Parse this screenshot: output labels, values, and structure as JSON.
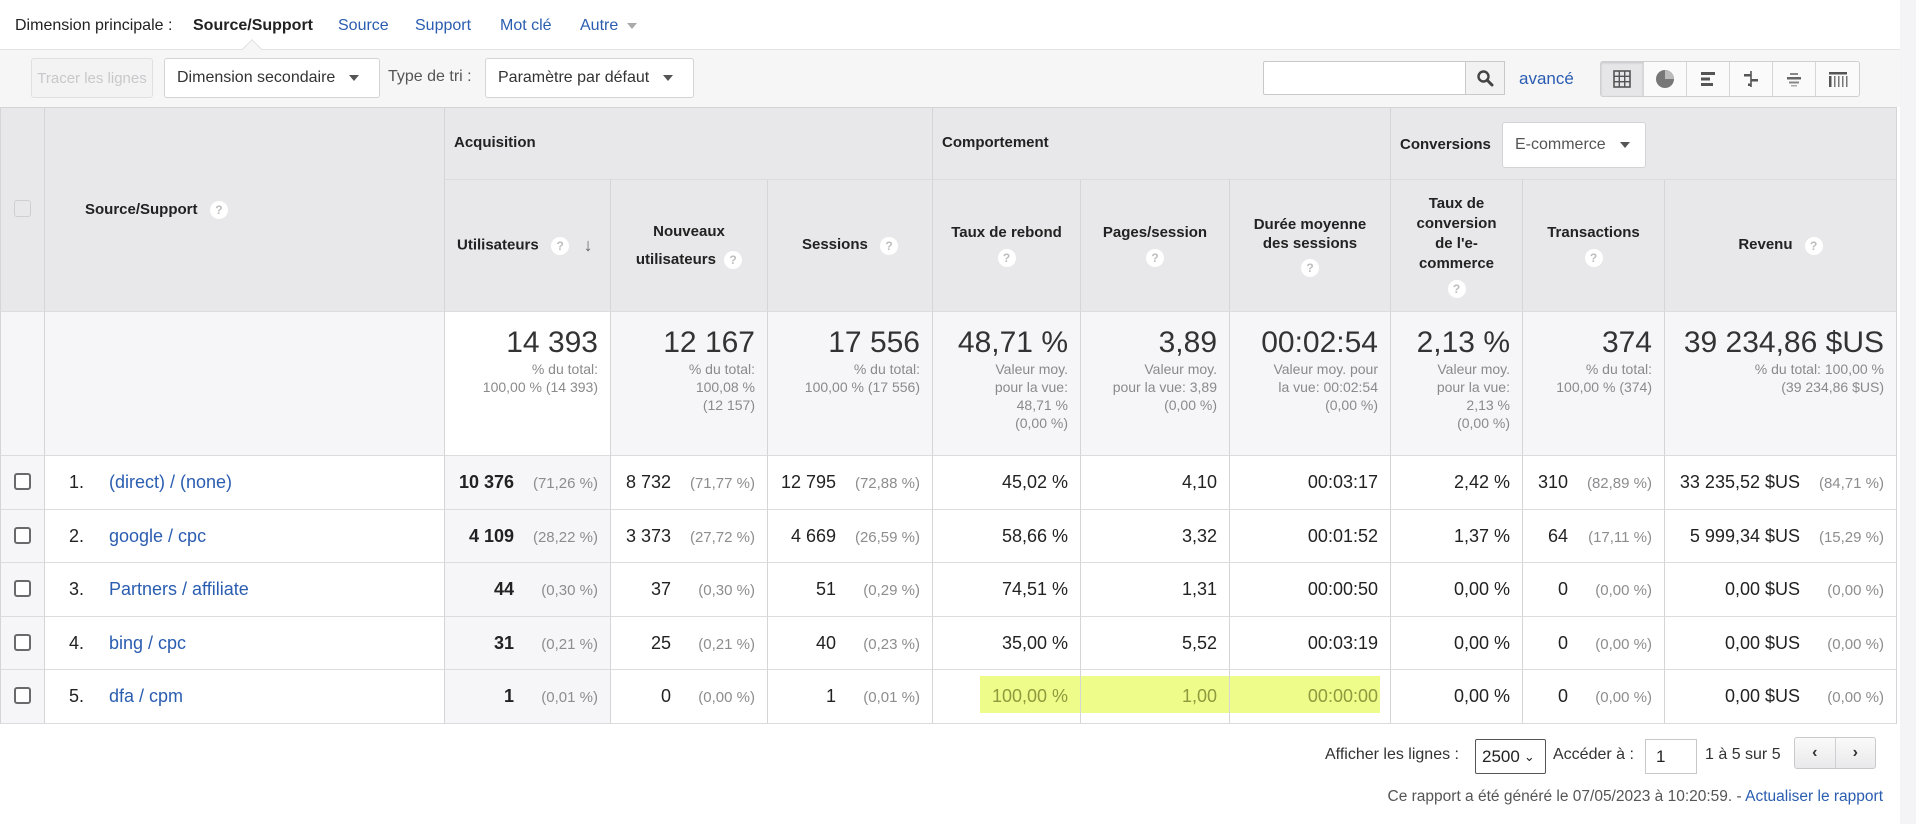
{
  "dimension_bar": {
    "label": "Dimension principale :",
    "active": "Source/Support",
    "links": [
      "Source",
      "Support",
      "Mot clé",
      "Autre"
    ]
  },
  "toolbar": {
    "plot_rows": "Tracer les lignes",
    "secondary_dimension": "Dimension secondaire",
    "sort_type_label": "Type de tri :",
    "sort_type_value": "Paramètre par défaut",
    "search_value": "",
    "advanced": "avancé",
    "view_buttons": [
      "table-view",
      "pie-view",
      "performance-view",
      "comparison-view",
      "term-cloud-view",
      "pivot-view"
    ]
  },
  "table": {
    "dimension_header": "Source/Support",
    "groups": {
      "acquisition": "Acquisition",
      "behavior": "Comportement",
      "conversions": "Conversions",
      "conversions_select": "E-commerce"
    },
    "columns": [
      {
        "key": "users",
        "label": "Utilisateurs"
      },
      {
        "key": "new_users",
        "label": "Nouveaux utilisateurs"
      },
      {
        "key": "sessions",
        "label": "Sessions"
      },
      {
        "key": "bounce",
        "label": "Taux de rebond"
      },
      {
        "key": "pages",
        "label": "Pages/session"
      },
      {
        "key": "duration",
        "label": "Durée moyenne des sessions"
      },
      {
        "key": "conv_rate",
        "label": "Taux de conversion de l'e-commerce"
      },
      {
        "key": "transactions",
        "label": "Transactions"
      },
      {
        "key": "revenue",
        "label": "Revenu"
      }
    ],
    "totals": {
      "users": {
        "value": "14 393",
        "lines": [
          "% du total:",
          "100,00 % (14 393)"
        ]
      },
      "new_users": {
        "value": "12 167",
        "lines": [
          "% du total:",
          "100,08 %",
          "(12 157)"
        ]
      },
      "sessions": {
        "value": "17 556",
        "lines": [
          "% du total:",
          "100,00 % (17 556)"
        ]
      },
      "bounce": {
        "value": "48,71 %",
        "lines": [
          "Valeur moy.",
          "pour la vue:",
          "48,71 %",
          "(0,00 %)"
        ]
      },
      "pages": {
        "value": "3,89",
        "lines": [
          "Valeur moy.",
          "pour la vue: 3,89",
          "(0,00 %)"
        ]
      },
      "duration": {
        "value": "00:02:54",
        "lines": [
          "Valeur moy. pour",
          "la vue: 00:02:54",
          "(0,00 %)"
        ]
      },
      "conv_rate": {
        "value": "2,13 %",
        "lines": [
          "Valeur moy.",
          "pour la vue:",
          "2,13 %",
          "(0,00 %)"
        ]
      },
      "transactions": {
        "value": "374",
        "lines": [
          "% du total:",
          "100,00 % (374)"
        ]
      },
      "revenue": {
        "value": "39 234,86 $US",
        "lines": [
          "% du total: 100,00 %",
          "(39 234,86 $US)"
        ]
      }
    },
    "rows": [
      {
        "num": "1.",
        "name": "(direct) / (none)",
        "users": "10 376",
        "users_pct": "(71,26 %)",
        "new_users": "8 732",
        "new_users_pct": "(71,77 %)",
        "sessions": "12 795",
        "sessions_pct": "(72,88 %)",
        "bounce": "45,02 %",
        "pages": "4,10",
        "duration": "00:03:17",
        "conv_rate": "2,42 %",
        "transactions": "310",
        "transactions_pct": "(82,89 %)",
        "revenue": "33 235,52 $US",
        "revenue_pct": "(84,71 %)"
      },
      {
        "num": "2.",
        "name": "google / cpc",
        "users": "4 109",
        "users_pct": "(28,22 %)",
        "new_users": "3 373",
        "new_users_pct": "(27,72 %)",
        "sessions": "4 669",
        "sessions_pct": "(26,59 %)",
        "bounce": "58,66 %",
        "pages": "3,32",
        "duration": "00:01:52",
        "conv_rate": "1,37 %",
        "transactions": "64",
        "transactions_pct": "(17,11 %)",
        "revenue": "5 999,34 $US",
        "revenue_pct": "(15,29 %)"
      },
      {
        "num": "3.",
        "name": "Partners / affiliate",
        "users": "44",
        "users_pct": "(0,30 %)",
        "new_users": "37",
        "new_users_pct": "(0,30 %)",
        "sessions": "51",
        "sessions_pct": "(0,29 %)",
        "bounce": "74,51 %",
        "pages": "1,31",
        "duration": "00:00:50",
        "conv_rate": "0,00 %",
        "transactions": "0",
        "transactions_pct": "(0,00 %)",
        "revenue": "0,00 $US",
        "revenue_pct": "(0,00 %)"
      },
      {
        "num": "4.",
        "name": "bing / cpc",
        "users": "31",
        "users_pct": "(0,21 %)",
        "new_users": "25",
        "new_users_pct": "(0,21 %)",
        "sessions": "40",
        "sessions_pct": "(0,23 %)",
        "bounce": "35,00 %",
        "pages": "5,52",
        "duration": "00:03:19",
        "conv_rate": "0,00 %",
        "transactions": "0",
        "transactions_pct": "(0,00 %)",
        "revenue": "0,00 $US",
        "revenue_pct": "(0,00 %)"
      },
      {
        "num": "5.",
        "name": "dfa / cpm",
        "users": "1",
        "users_pct": "(0,01 %)",
        "new_users": "0",
        "new_users_pct": "(0,00 %)",
        "sessions": "1",
        "sessions_pct": "(0,01 %)",
        "bounce": "100,00 %",
        "pages": "1,00",
        "duration": "00:00:00",
        "conv_rate": "0,00 %",
        "transactions": "0",
        "transactions_pct": "(0,00 %)",
        "revenue": "0,00 $US",
        "revenue_pct": "(0,00 %)",
        "highlighted": [
          "bounce",
          "pages",
          "duration"
        ]
      }
    ]
  },
  "footer": {
    "show_rows_label": "Afficher les lignes :",
    "show_rows_value": "2500",
    "goto_label": "Accéder à :",
    "goto_value": "1",
    "range_text": "1 à 5 sur 5",
    "prev": "‹",
    "next": "›",
    "generated_text": "Ce rapport a été généré le 07/05/2023 à 10:20:59. - ",
    "refresh_link": "Actualiser le rapport"
  },
  "colors": {
    "link": "#2a5db0",
    "header_bg": "#e8e8ea",
    "highlight": "#eefc8a"
  }
}
